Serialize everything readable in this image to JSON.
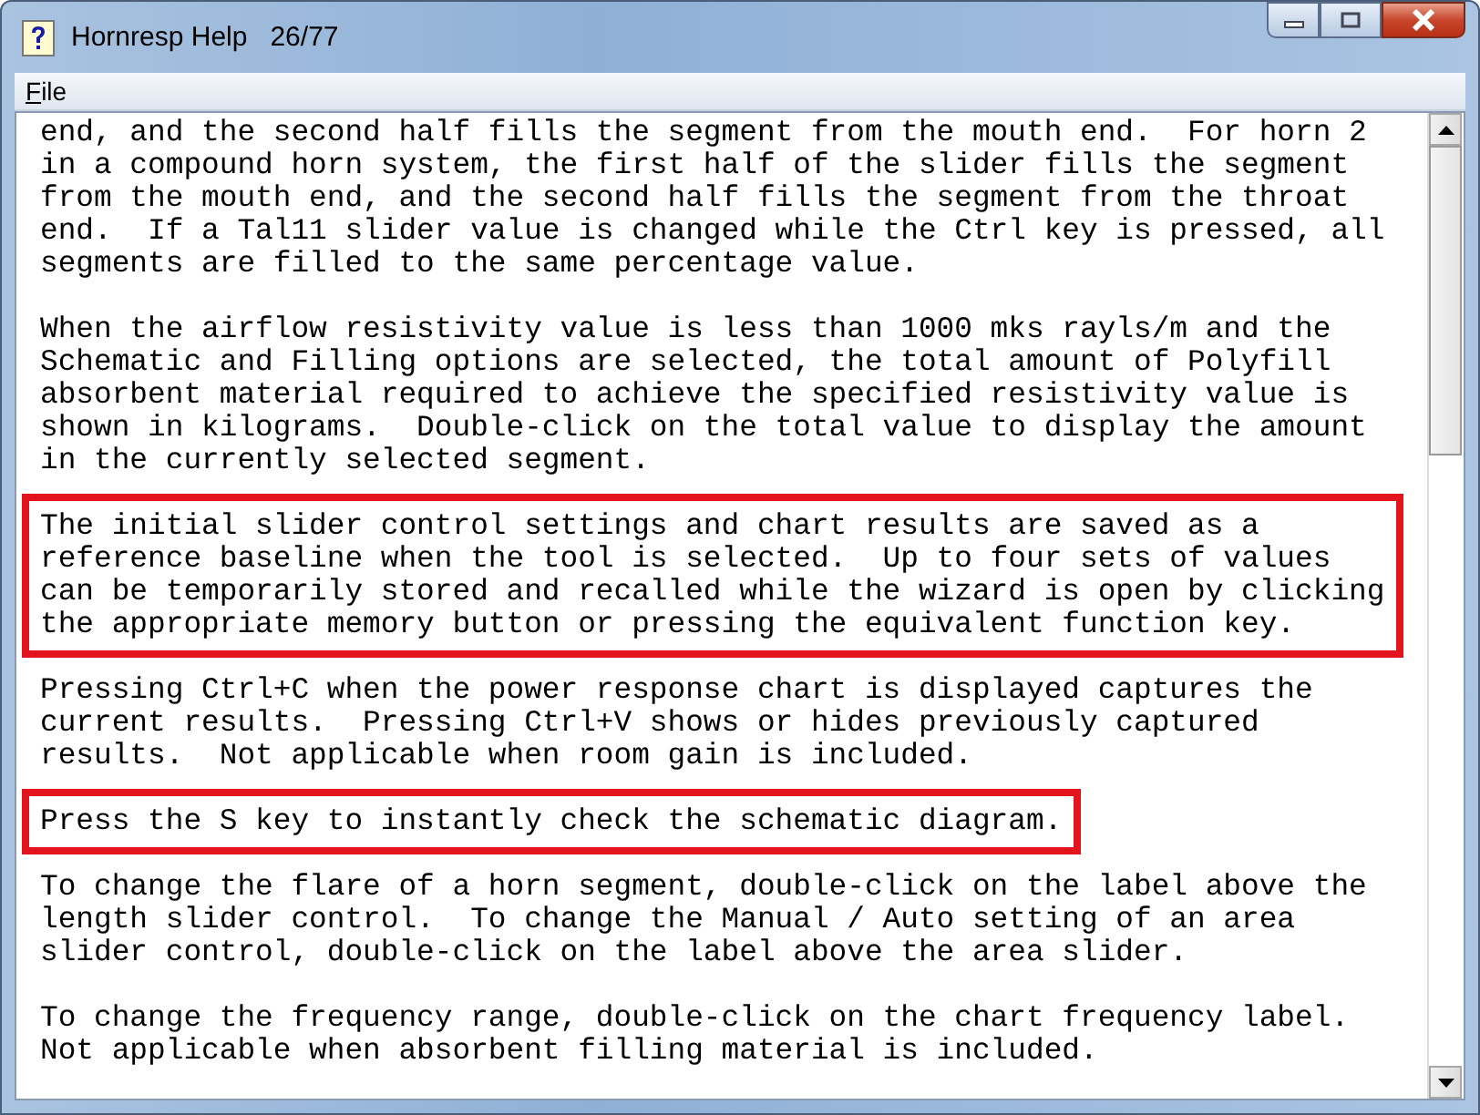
{
  "window": {
    "title": "Hornresp Help   26/77"
  },
  "menu": [
    "File"
  ],
  "paragraphs": [
    {
      "highlighted": false,
      "lines": [
        "end, and the second half fills the segment from the mouth end.  For horn 2",
        "in a compound horn system, the first half of the slider fills the segment",
        "from the mouth end, and the second half fills the segment from the throat",
        "end.  If a Tal11 slider value is changed while the Ctrl key is pressed, all",
        "segments are filled to the same percentage value."
      ]
    },
    {
      "highlighted": false,
      "lines": [
        "When the airflow resistivity value is less than 1000 mks rayls/m and the",
        "Schematic and Filling options are selected, the total amount of Polyfill",
        "absorbent material required to achieve the specified resistivity value is",
        "shown in kilograms.  Double-click on the total value to display the amount",
        "in the currently selected segment."
      ]
    },
    {
      "highlighted": true,
      "lines": [
        "The initial slider control settings and chart results are saved as a",
        "reference baseline when the tool is selected.  Up to four sets of values",
        "can be temporarily stored and recalled while the wizard is open by clicking",
        "the appropriate memory button or pressing the equivalent function key."
      ]
    },
    {
      "highlighted": false,
      "lines": [
        "Pressing Ctrl+C when the power response chart is displayed captures the",
        "current results.  Pressing Ctrl+V shows or hides previously captured",
        "results.  Not applicable when room gain is included."
      ]
    },
    {
      "highlighted": true,
      "lines": [
        "Press the S key to instantly check the schematic diagram."
      ]
    },
    {
      "highlighted": false,
      "lines": [
        "To change the flare of a horn segment, double-click on the label above the",
        "length slider control.  To change the Manual / Auto setting of an area",
        "slider control, double-click on the label above the area slider."
      ]
    },
    {
      "highlighted": false,
      "lines": [
        "To change the frequency range, double-click on the chart frequency label.",
        "Not applicable when absorbent filling material is included."
      ]
    }
  ]
}
